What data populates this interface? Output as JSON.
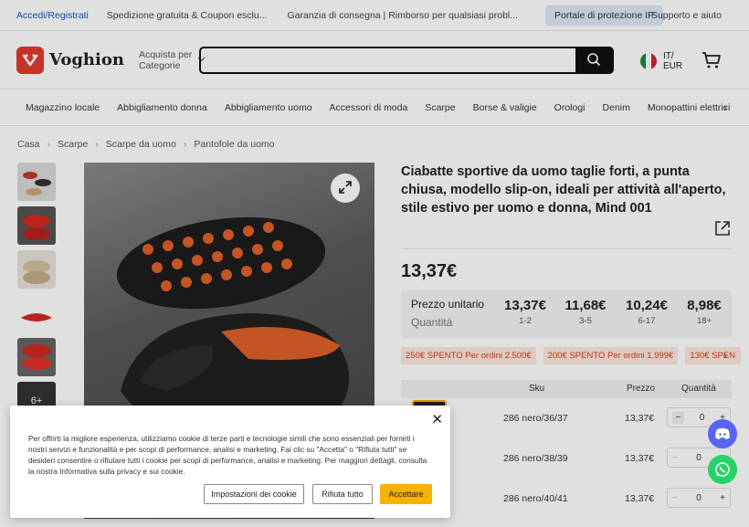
{
  "topbar": {
    "login": "Accedi/Registrati",
    "shipping": "Spedizione gratuita & Coupon esclu...",
    "guarantee": "Garanzia di consegna | Rimborso per qualsiasi probl...",
    "ip_portal": "Portale di protezione IP",
    "support": "Supporto e aiuto"
  },
  "header": {
    "logo_text": "Voghion",
    "category_line1": "Acquista per",
    "category_line2": "Categorie",
    "search_placeholder": "",
    "locale_country": "IT/",
    "locale_currency": "EUR",
    "icons": [
      "search-icon",
      "cart-icon",
      "italy-flag-icon",
      "chevron-down-icon"
    ]
  },
  "nav": {
    "categories": [
      "Magazzino locale",
      "Abbigliamento donna",
      "Abbigliamento uomo",
      "Accessori di moda",
      "Scarpe",
      "Borse & valigie",
      "Orologi",
      "Denim",
      "Monopattini elettrici"
    ]
  },
  "breadcrumb": [
    "Casa",
    "Scarpe",
    "Scarpe da uomo",
    "Pantofole da uomo"
  ],
  "gallery": {
    "more_label": "6+"
  },
  "product": {
    "title": "Ciabatte sportive da uomo taglie forti, a punta chiusa, modello slip-on, ideali per attività all'aperto, stile estivo per uomo e donna, Mind 001",
    "price": "13,37€",
    "unit_price_label": "Prezzo unitario",
    "quantity_label": "Quantità",
    "tiers": [
      {
        "price": "13,37€",
        "qty": "1-2"
      },
      {
        "price": "11,68€",
        "qty": "3-5"
      },
      {
        "price": "10,24€",
        "qty": "6-17"
      },
      {
        "price": "8,98€",
        "qty": "18+"
      }
    ],
    "coupons": [
      "250€ SPENTO Per ordini 2.500€",
      "200€ SPENTO Per ordini 1.999€",
      "130€ SPEN"
    ]
  },
  "sku_table": {
    "headers": {
      "sku": "Sku",
      "price": "Prezzo",
      "qty": "Quantità"
    },
    "rows": [
      {
        "sku": "286 nero/36/37",
        "price": "13,37€",
        "qty": "0"
      },
      {
        "sku": "286 nero/38/39",
        "price": "13,37€",
        "qty": "0"
      },
      {
        "sku": "286 nero/40/41",
        "price": "13,37€",
        "qty": "0"
      }
    ]
  },
  "cookie": {
    "text": "Per offrirti la migliore esperienza, utilizziamo cookie di terze parti e tecnologie simili che sono essenziali per fornirti i nostri servizi e funzionalità e per scopi di performance, analisi e marketing. Fai clic su \"Accetta\" o \"Rifiuta tutti\" se desideri consentire o rifiutare tutti i cookie per scopi di performance, analisi e marketing. Per maggiori dettagli, consulta la nostra Informativa sulla privacy e sui cookie.",
    "settings_label": "Impostazioni dei cookie",
    "reject_label": "Rifiuta tutto",
    "accept_label": "Accettare"
  },
  "colors": {
    "brand_red": "#e23b2e",
    "accept_yellow": "#f5b300",
    "coupon_red": "#d0421c",
    "discord": "#5865f2",
    "whatsapp": "#25d366"
  }
}
